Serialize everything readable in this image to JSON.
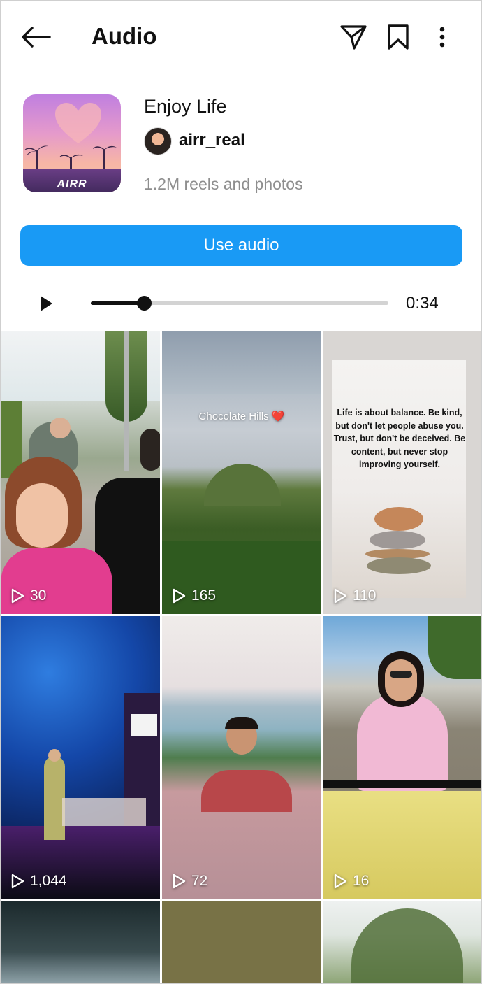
{
  "header": {
    "title": "Audio",
    "icons": [
      "back-arrow-icon",
      "send-icon",
      "bookmark-icon",
      "more-vertical-icon"
    ]
  },
  "audio": {
    "cover_tag": "AIRR",
    "title": "Enjoy Life",
    "username": "airr_real",
    "count": "1.2M reels and photos",
    "use_button": "Use audio"
  },
  "player": {
    "duration": "0:34",
    "progress": 0.18
  },
  "colors": {
    "accent": "#199af5",
    "text": "#111111",
    "muted": "#8e8e8e"
  },
  "grid": [
    {
      "views": "30"
    },
    {
      "views": "165",
      "overlay": "Chocolate Hills ❤️"
    },
    {
      "views": "110",
      "quote": "Life is about balance. Be kind, but don't let people abuse you. Trust, but don't be deceived. Be content, but never stop improving yourself."
    },
    {
      "views": "1,044"
    },
    {
      "views": "72"
    },
    {
      "views": "16"
    },
    {
      "views": ""
    },
    {
      "views": ""
    },
    {
      "views": ""
    }
  ]
}
